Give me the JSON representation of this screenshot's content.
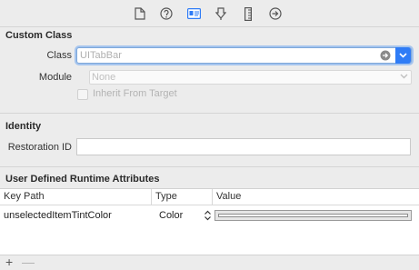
{
  "toolbar": {
    "icons": [
      "file-inspector-icon",
      "quick-help-icon",
      "identity-inspector-icon",
      "attributes-inspector-icon",
      "size-inspector-icon",
      "connections-inspector-icon"
    ],
    "active": "identity-inspector-icon",
    "accent": "#2f7cf6"
  },
  "custom_class": {
    "title": "Custom Class",
    "class_label": "Class",
    "class_placeholder": "UITabBar",
    "class_value": "",
    "module_label": "Module",
    "module_placeholder": "None",
    "module_value": "",
    "inherit_label": "Inherit From Target",
    "inherit_checked": false
  },
  "identity": {
    "title": "Identity",
    "restoration_label": "Restoration ID",
    "restoration_value": ""
  },
  "runtime_attributes": {
    "title": "User Defined Runtime Attributes",
    "columns": [
      "Key Path",
      "Type",
      "Value"
    ],
    "rows": [
      {
        "key_path": "unselectedItemTintColor",
        "type": "Color",
        "value_color": "#ffffff"
      }
    ]
  },
  "bottom_bar": {
    "add_label": "+",
    "remove_label": "—"
  }
}
